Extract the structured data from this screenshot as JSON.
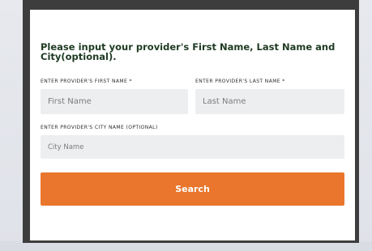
{
  "modal": {
    "heading": "Please input your provider's First Name, Last Name and City(optional).",
    "first_name": {
      "label": "ENTER PROVIDER'S FIRST NAME *",
      "placeholder": "First Name",
      "value": ""
    },
    "last_name": {
      "label": "ENTER PROVIDER'S LAST NAME *",
      "placeholder": "Last Name",
      "value": ""
    },
    "city_name": {
      "label": "ENTER PROVIDER'S CITY NAME (OPTIONAL)",
      "placeholder": "City Name",
      "value": ""
    },
    "search_button_label": "Search"
  },
  "colors": {
    "accent": "#e9762c",
    "heading": "#1e3a22",
    "input_bg": "#eceeef",
    "frame": "#3d3d3d"
  }
}
